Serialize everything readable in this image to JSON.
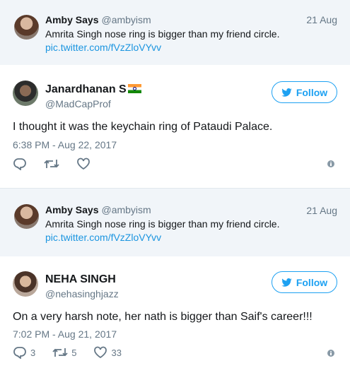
{
  "quote1": {
    "name": "Amby Says",
    "handle": "@ambyism",
    "date": "21 Aug",
    "text": "Amrita Singh nose ring is bigger than my friend circle.",
    "link": "pic.twitter.com/fVzZloVYvv"
  },
  "tweet1": {
    "name": "Janardhanan S",
    "handle": "@MadCapProf",
    "follow_label": "Follow",
    "text": "I thought it was the keychain ring of Pataudi Palace.",
    "time": "6:38 PM - Aug 22, 2017"
  },
  "quote2": {
    "name": "Amby Says",
    "handle": "@ambyism",
    "date": "21 Aug",
    "text": "Amrita Singh nose ring is bigger than my friend circle.",
    "link": "pic.twitter.com/fVzZloVYvv"
  },
  "tweet2": {
    "name": "NEHA SINGH",
    "handle": "@nehasinghjazz",
    "follow_label": "Follow",
    "text": "On a very harsh note, her nath is bigger than Saif's career!!!",
    "time": "7:02 PM - Aug 21, 2017",
    "replies": "3",
    "retweets": "5",
    "likes": "33"
  },
  "icons": {
    "reply": "reply-icon",
    "retweet": "retweet-icon",
    "like": "heart-icon",
    "info": "info-icon",
    "twitter": "twitter-bird-icon",
    "flag": "india-flag-icon"
  },
  "colors": {
    "accent": "#1da1f2",
    "link": "#1b95e0",
    "secondary_text": "#657786",
    "quote_bg": "#f1f5f9"
  }
}
